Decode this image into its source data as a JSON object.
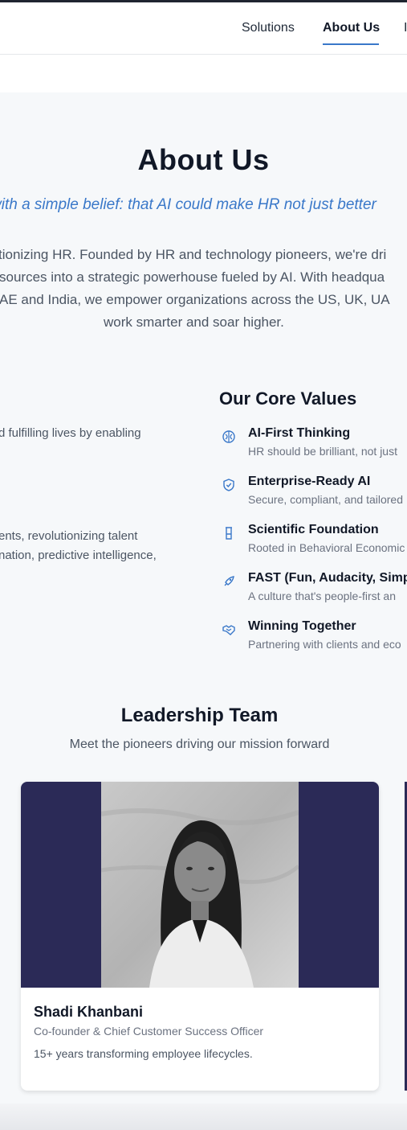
{
  "nav": {
    "items": [
      "Solutions",
      "About Us",
      "I"
    ],
    "active": "About Us"
  },
  "hero": {
    "title": "About Us",
    "tagline": "with a simple belief: that AI could make HR not just better",
    "intro_lines": [
      "tionizing HR. Founded by HR and technology pioneers, we're dri",
      "sources into a strategic powerhouse fueled by AI. With headqua",
      "AE and India, we empower organizations across the US, UK, UA",
      "work smarter and soar higher."
    ]
  },
  "mission": {
    "lines": [
      "d fulfilling lives by enabling",
      "ents, revolutionizing talent",
      "nation, predictive intelligence,"
    ]
  },
  "core_values": {
    "title": "Our Core Values",
    "items": [
      {
        "icon": "brain-icon",
        "title": "AI-First Thinking",
        "desc": "HR should be brilliant, not just"
      },
      {
        "icon": "shield-check-icon",
        "title": "Enterprise-Ready AI",
        "desc": "Secure, compliant, and tailored"
      },
      {
        "icon": "flask-icon",
        "title": "Scientific Foundation",
        "desc": "Rooted in Behavioral Economic"
      },
      {
        "icon": "rocket-icon",
        "title": "FAST (Fun, Audacity, Simp",
        "desc": "A culture that's people-first an"
      },
      {
        "icon": "handshake-icon",
        "title": "Winning Together",
        "desc": "Partnering with clients and eco"
      }
    ]
  },
  "leadership": {
    "title": "Leadership Team",
    "subtitle": "Meet the pioneers driving our mission forward",
    "members": [
      {
        "name": "Shadi Khanbani",
        "role": "Co-founder & Chief Customer Success Officer",
        "bio": "15+ years transforming employee lifecycles."
      }
    ]
  },
  "colors": {
    "accent": "#3a78c9",
    "photo_bg": "#2b2a57"
  }
}
